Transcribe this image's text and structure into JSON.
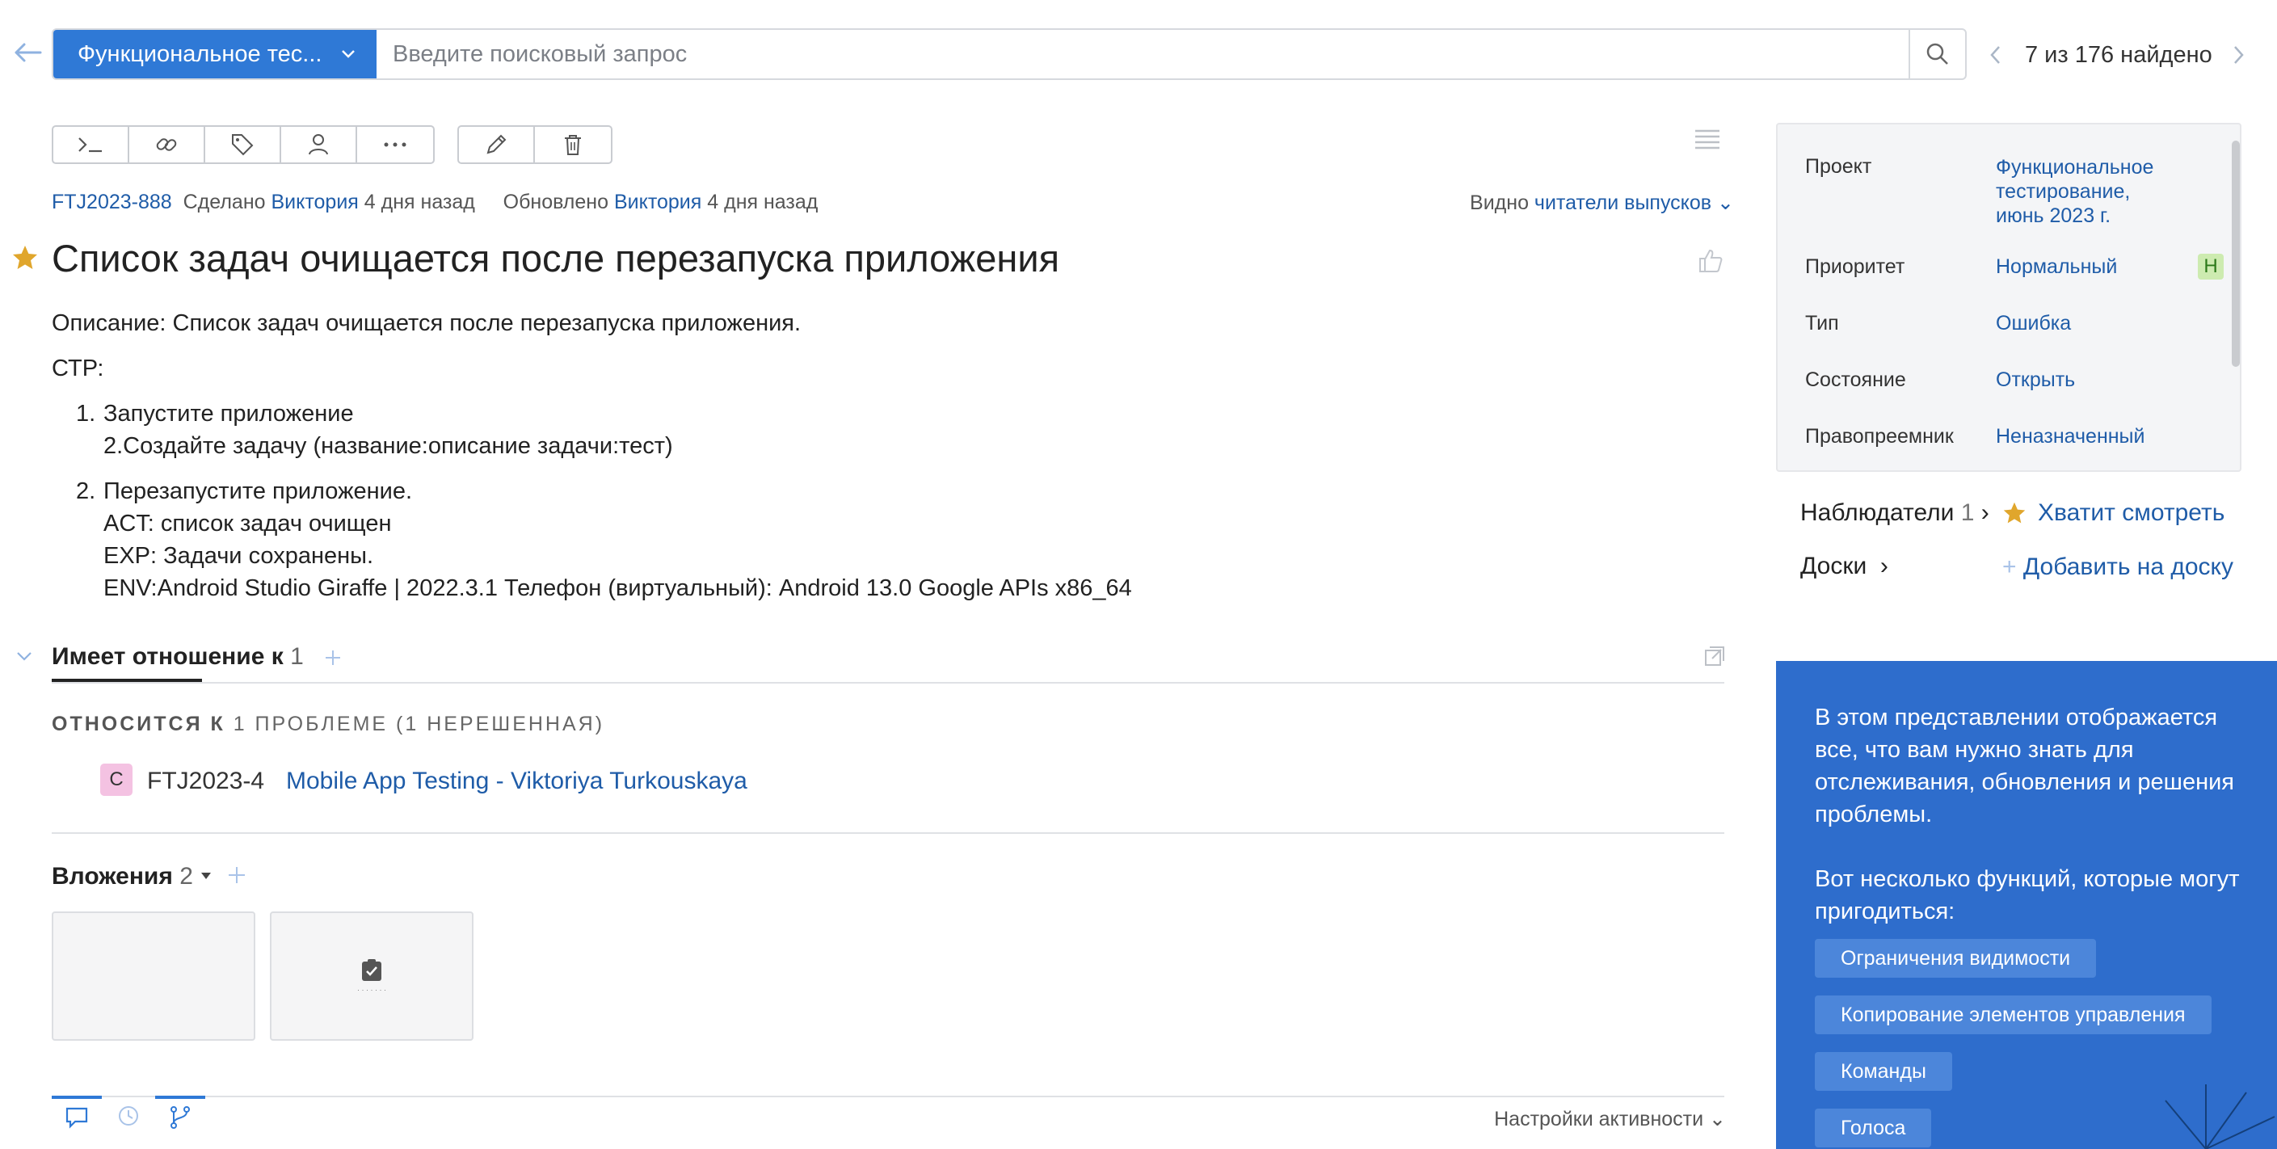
{
  "search": {
    "project": "Функциональное тес...",
    "placeholder": "Введите поисковый запрос",
    "result_count": "7 из 176 найдено"
  },
  "meta": {
    "issue_id": "FTJ2023-888",
    "done_label": "Сделано",
    "done_by": "Виктория",
    "done_when": "4 дня назад",
    "updated_label": "Обновлено",
    "updated_by": "Виктория",
    "updated_when": "4 дня назад",
    "visible_label": "Видно",
    "visible_value": "читатели выпусков"
  },
  "issue": {
    "title": "Список задач очищается после перезапуска приложения",
    "description_line": "Описание: Список задач очищается после перезапуска приложения.",
    "str_label": "СТР:",
    "step1_num": "1.",
    "step1": "Запустите приложение",
    "step1b": "2.Создайте задачу (название:описание задачи:тест)",
    "step2_num": "2.",
    "step2": "Перезапустите приложение.",
    "act": "ACT: список задач очищен",
    "exp": "EXP: Задачи сохранены.",
    "env": "ENV:Android Studio Giraffe | 2022.3.1 Телефон (виртуальный): Android 13.0 Google APIs x86_64"
  },
  "relations": {
    "tab_label": "Имеет отношение к",
    "tab_count": "1",
    "heading_bold": "ОТНОСИТСЯ К",
    "heading_rest": "1 ПРОБЛЕМЕ (1 НЕРЕШЕННАЯ)",
    "items": [
      {
        "badge": "C",
        "id": "FTJ2023-4",
        "title": "Mobile App Testing - Viktoriya Turkouskaya"
      }
    ]
  },
  "attachments": {
    "label": "Вложения",
    "count": "2"
  },
  "activity": {
    "settings_label": "Настройки активности"
  },
  "details": {
    "project_label": "Проект",
    "project_value_l1": "Функциональное",
    "project_value_l2": "тестирование,",
    "project_value_l3": "июнь 2023 г.",
    "priority_label": "Приоритет",
    "priority_value": "Нормальный",
    "priority_badge": "Н",
    "type_label": "Тип",
    "type_value": "Ошибка",
    "state_label": "Состояние",
    "state_value": "Открыть",
    "assignee_label": "Правопреемник",
    "assignee_value": "Неназначенный"
  },
  "watchers": {
    "label": "Наблюдатели",
    "count": "1",
    "stop_label": "Хватит смотреть"
  },
  "boards": {
    "label": "Доски",
    "add_label": "Добавить на доску"
  },
  "tip": {
    "text1": "В этом представлении отображается все, что вам нужно знать для отслеживания, обновления и решения проблемы.",
    "text2": "Вот несколько функций, которые могут пригодиться:",
    "buttons": [
      "Ограничения видимости",
      "Копирование элементов управления",
      "Команды",
      "Голоса"
    ]
  },
  "colors": {
    "accent": "#2f79d6",
    "link": "#1f5ca8",
    "star": "#e0a62c",
    "tip_bg": "#2e6dcc"
  }
}
